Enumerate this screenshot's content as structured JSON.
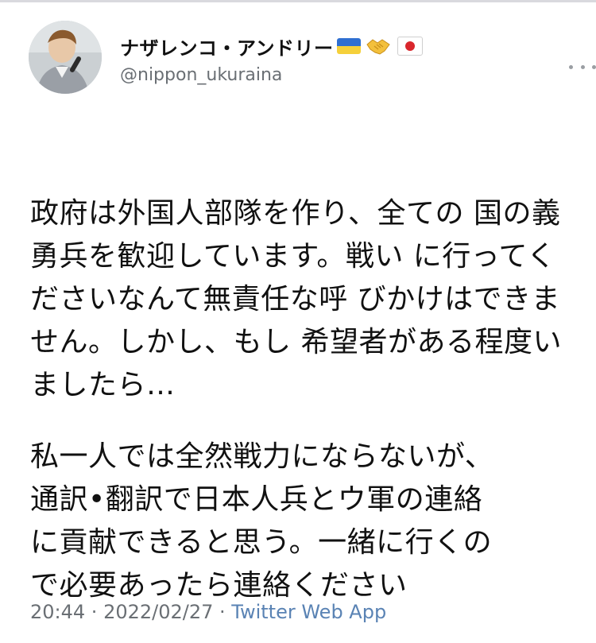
{
  "user": {
    "display_name": "ナザレンコ・アンドリー",
    "handle": "@nippon_ukuraina",
    "name_emojis": [
      "flag-ukraine-icon",
      "handshake-icon",
      "flag-japan-icon"
    ]
  },
  "tweet": {
    "paragraph_1": "政府は外国人部隊を作り、全ての\n国の義勇兵を歓迎しています。戦い\nに行ってくださいなんて無責任な呼\nびかけはできません。しかし、もし\n希望者がある程度いましたら…",
    "paragraph_2": "私一人では全然戦力にならないが、\n通訳•翻訳で日本人兵とウ軍の連絡\nに貢献できると思う。一緒に行くの\nで必要あったら連絡ください"
  },
  "meta": {
    "time": "20:44",
    "separator": " · ",
    "date": "2022/02/27",
    "separator_2": " · ",
    "source": "Twitter Web App"
  },
  "colors": {
    "ukraine_blue": "#2f6fd1",
    "ukraine_yellow": "#f5d03a",
    "japan_red": "#d9262c",
    "source_link": "#5a83b4",
    "muted_text": "#6a6f74"
  }
}
